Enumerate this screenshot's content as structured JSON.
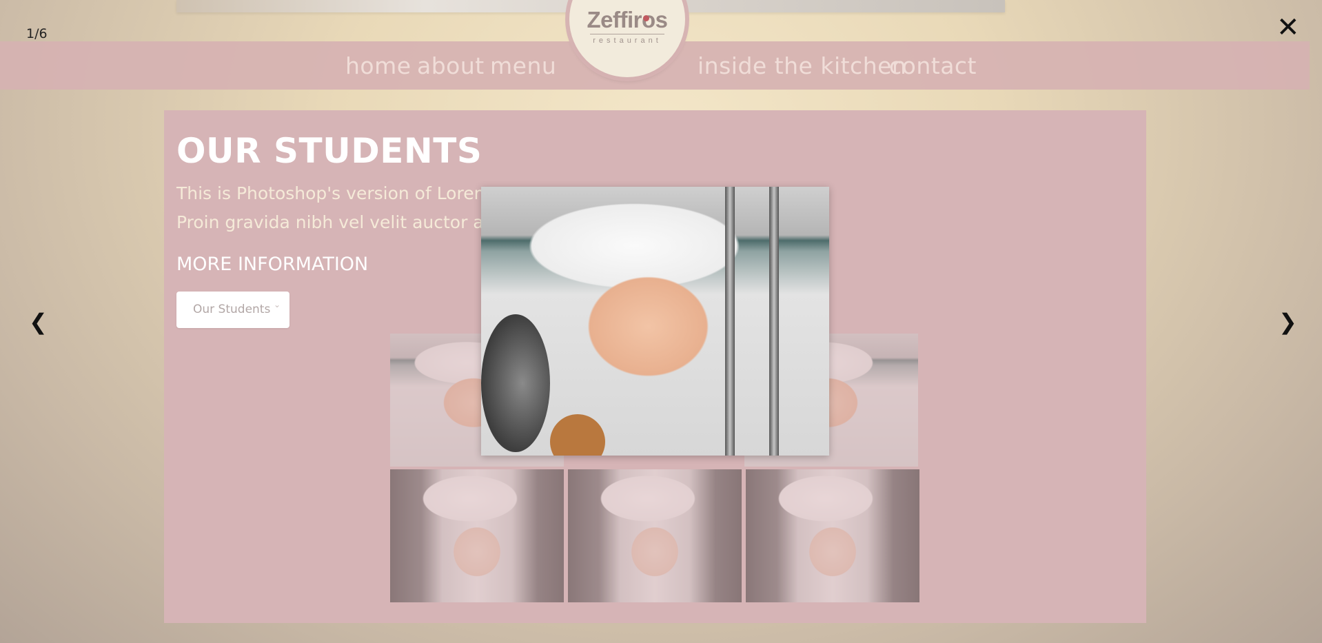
{
  "counter": "1/6",
  "nav": {
    "left": [
      "home",
      "about",
      "menu"
    ],
    "right": [
      "inside the kitchen",
      "contact"
    ]
  },
  "logo": {
    "word": "Zeffiros",
    "sub": "restaurant"
  },
  "close_icon": "close-icon",
  "arrows": {
    "prev": "❮",
    "next": "❯"
  },
  "content": {
    "heading": "OUR STUDENTS",
    "body_line1": "This is Photoshop's version of Lorem",
    "body_line2": "Proin gravida nibh vel velit auctor ali",
    "more_info": "MORE INFORMATION",
    "select": {
      "value": "Our Students",
      "chevron": "⌄"
    }
  },
  "gallery": {
    "main": "chef-woman-photo",
    "top_row": [
      "chef-woman-photo",
      "chef-woman-photo"
    ],
    "bottom_row": [
      "chef-man-photo",
      "chef-man-photo",
      "chef-man-photo"
    ]
  }
}
